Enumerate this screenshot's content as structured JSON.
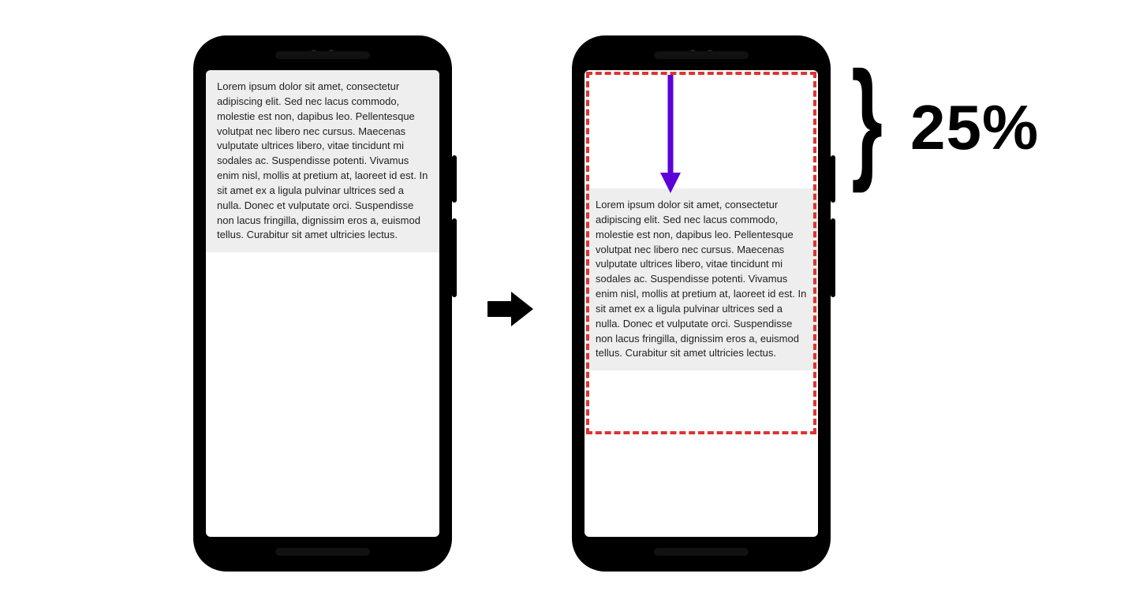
{
  "placeholder_text": "Lorem ipsum dolor sit amet, consectetur adipiscing elit. Sed nec lacus commodo, molestie est non, dapibus leo. Pellentesque volutpat nec libero nec cursus. Maecenas vulputate ultrices libero, vitae tincidunt mi sodales ac. Suspendisse potenti. Vivamus enim nisl, mollis at pretium at, laoreet id est. In sit amet ex a ligula pulvinar ultrices sed a nulla. Donec et vulputate orci. Suspendisse non lacus fringilla, dignissim eros a, euismod tellus. Curabitur sit amet ultricies lectus.",
  "shift_label": "25%",
  "brace_glyph": "}",
  "colors": {
    "dash_border": "#d33",
    "arrow": "#5b00d8",
    "text_bg": "#eeeeee"
  }
}
